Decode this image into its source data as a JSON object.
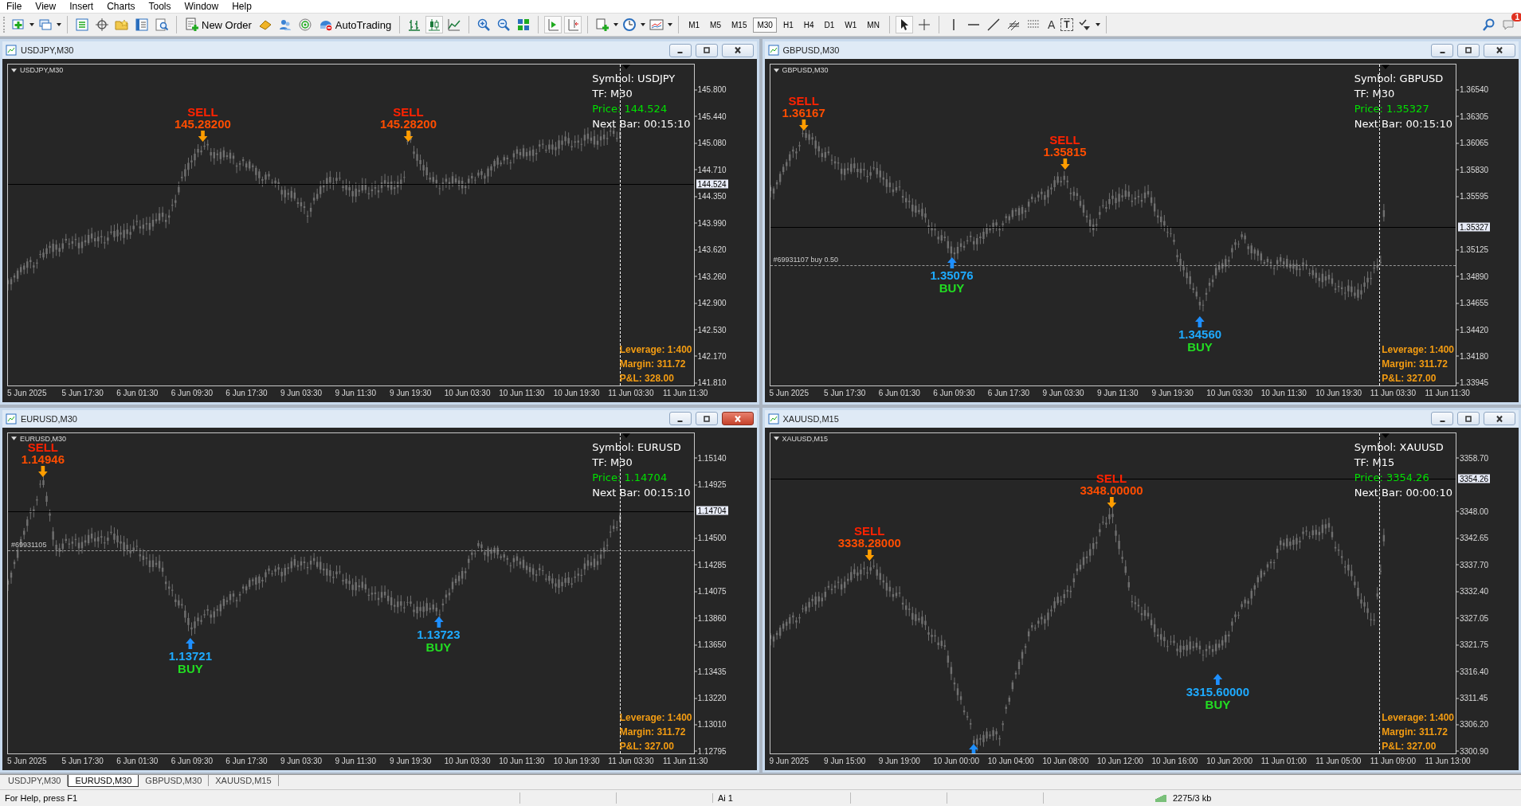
{
  "menu": [
    "File",
    "View",
    "Insert",
    "Charts",
    "Tools",
    "Window",
    "Help"
  ],
  "toolbar": {
    "new_order": "New Order",
    "autotrading": "AutoTrading",
    "timeframes": [
      {
        "label": "M1",
        "selected": false
      },
      {
        "label": "M5",
        "selected": false
      },
      {
        "label": "M15",
        "selected": false
      },
      {
        "label": "M30",
        "selected": true
      },
      {
        "label": "H1",
        "selected": false
      },
      {
        "label": "H4",
        "selected": false
      },
      {
        "label": "D1",
        "selected": false
      },
      {
        "label": "W1",
        "selected": false
      },
      {
        "label": "MN",
        "selected": false
      }
    ],
    "text_tools": [
      "A",
      "T"
    ],
    "notification_count": "1"
  },
  "charts": [
    {
      "title": "USDJPY,M30",
      "active": false,
      "label": "USDJPY,M30",
      "info": [
        "Symbol: USDJPY",
        "TF: M30",
        "Price: 144.524",
        "Next Bar: 00:15:10"
      ],
      "account": [
        "Leverage: 1:400",
        "Margin: 311.72",
        "P&L: 328.00"
      ],
      "price_ticks": [
        "145.800",
        "145.440",
        "145.080",
        "144.710",
        "144.350",
        "143.990",
        "143.620",
        "143.260",
        "142.900",
        "142.530",
        "142.170",
        "141.810"
      ],
      "current_price": "144.524",
      "time_labels": [
        "5 Jun 2025",
        "5 Jun 17:30",
        "6 Jun 01:30",
        "6 Jun 09:30",
        "6 Jun 17:30",
        "9 Jun 03:30",
        "9 Jun 11:30",
        "9 Jun 19:30",
        "10 Jun 03:30",
        "10 Jun 11:30",
        "10 Jun 19:30",
        "11 Jun 03:30",
        "11 Jun 11:30"
      ],
      "signals": [
        {
          "kind": "sell",
          "label": "SELL",
          "price": "145.28200"
        },
        {
          "kind": "sell",
          "label": "SELL",
          "price": "145.28200"
        }
      ]
    },
    {
      "title": "GBPUSD,M30",
      "active": false,
      "label": "GBPUSD,M30",
      "info": [
        "Symbol: GBPUSD",
        "TF: M30",
        "Price: 1.35327",
        "Next Bar: 00:15:10"
      ],
      "account": [
        "Leverage: 1:400",
        "Margin: 311.72",
        "P&L: 327.00"
      ],
      "price_ticks": [
        "1.36540",
        "1.36305",
        "1.36065",
        "1.35830",
        "1.35595",
        "1.35125",
        "1.34890",
        "1.34655",
        "1.34420",
        "1.34180",
        "1.33945"
      ],
      "current_price": "1.35327",
      "order_line": "#69931107 buy 0.50",
      "time_labels": [
        "5 Jun 2025",
        "5 Jun 17:30",
        "6 Jun 01:30",
        "6 Jun 09:30",
        "6 Jun 17:30",
        "9 Jun 03:30",
        "9 Jun 11:30",
        "9 Jun 19:30",
        "10 Jun 03:30",
        "10 Jun 11:30",
        "10 Jun 19:30",
        "11 Jun 03:30",
        "11 Jun 11:30"
      ],
      "signals": [
        {
          "kind": "sell",
          "label": "SELL",
          "price": "1.36167"
        },
        {
          "kind": "sell",
          "label": "SELL",
          "price": "1.35815"
        },
        {
          "kind": "buy",
          "label": "BUY",
          "price": "1.35076"
        },
        {
          "kind": "buy",
          "label": "BUY",
          "price": "1.34560"
        }
      ]
    },
    {
      "title": "EURUSD,M30",
      "active": true,
      "label": "EURUSD,M30",
      "info": [
        "Symbol: EURUSD",
        "TF: M30",
        "Price: 1.14704",
        "Next Bar: 00:15:10"
      ],
      "account": [
        "Leverage: 1:400",
        "Margin: 311.72",
        "P&L: 327.00"
      ],
      "price_ticks": [
        "1.15140",
        "1.14925",
        "1.14500",
        "1.14285",
        "1.14075",
        "1.13860",
        "1.13650",
        "1.13435",
        "1.13220",
        "1.13010",
        "1.12795"
      ],
      "current_price": "1.14704",
      "order_line": "#69931105",
      "time_labels": [
        "5 Jun 2025",
        "5 Jun 17:30",
        "6 Jun 01:30",
        "6 Jun 09:30",
        "6 Jun 17:30",
        "9 Jun 03:30",
        "9 Jun 11:30",
        "9 Jun 19:30",
        "10 Jun 03:30",
        "10 Jun 11:30",
        "10 Jun 19:30",
        "11 Jun 03:30",
        "11 Jun 11:30"
      ],
      "signals": [
        {
          "kind": "sell",
          "label": "SELL",
          "price": "1.14946"
        },
        {
          "kind": "buy",
          "label": "BUY",
          "price": "1.13721"
        },
        {
          "kind": "buy",
          "label": "BUY",
          "price": "1.13723"
        }
      ]
    },
    {
      "title": "XAUUSD,M15",
      "active": false,
      "label": "XAUUSD,M15",
      "info": [
        "Symbol: XAUUSD",
        "TF: M15",
        "Price: 3354.26",
        "Next Bar: 00:00:10"
      ],
      "account": [
        "Leverage: 1:400",
        "Margin: 311.72",
        "P&L: 327.00"
      ],
      "price_ticks": [
        "3358.70",
        "3348.00",
        "3342.65",
        "3337.70",
        "3332.40",
        "3327.05",
        "3321.75",
        "3316.40",
        "3311.45",
        "3306.20",
        "3300.90"
      ],
      "current_price": "3354.26",
      "time_labels": [
        "9 Jun 2025",
        "9 Jun 15:00",
        "9 Jun 19:00",
        "10 Jun 00:00",
        "10 Jun 04:00",
        "10 Jun 08:00",
        "10 Jun 12:00",
        "10 Jun 16:00",
        "10 Jun 20:00",
        "11 Jun 01:00",
        "11 Jun 05:00",
        "11 Jun 09:00",
        "11 Jun 13:00"
      ],
      "signals": [
        {
          "kind": "sell",
          "label": "SELL",
          "price": "3338.28000"
        },
        {
          "kind": "sell",
          "label": "SELL",
          "price": "3348.00000"
        },
        {
          "kind": "buy",
          "label": "BUY",
          "price": "3315.60000"
        },
        {
          "kind": "buy"
        }
      ]
    }
  ],
  "tabs": [
    {
      "label": "USDJPY,M30",
      "selected": false
    },
    {
      "label": "EURUSD,M30",
      "selected": true
    },
    {
      "label": "GBPUSD,M30",
      "selected": false
    },
    {
      "label": "XAUUSD,M15",
      "selected": false
    }
  ],
  "status_bar": {
    "help": "For Help, press F1",
    "profile": "Ai 1",
    "traffic": "2275/3 kb"
  }
}
